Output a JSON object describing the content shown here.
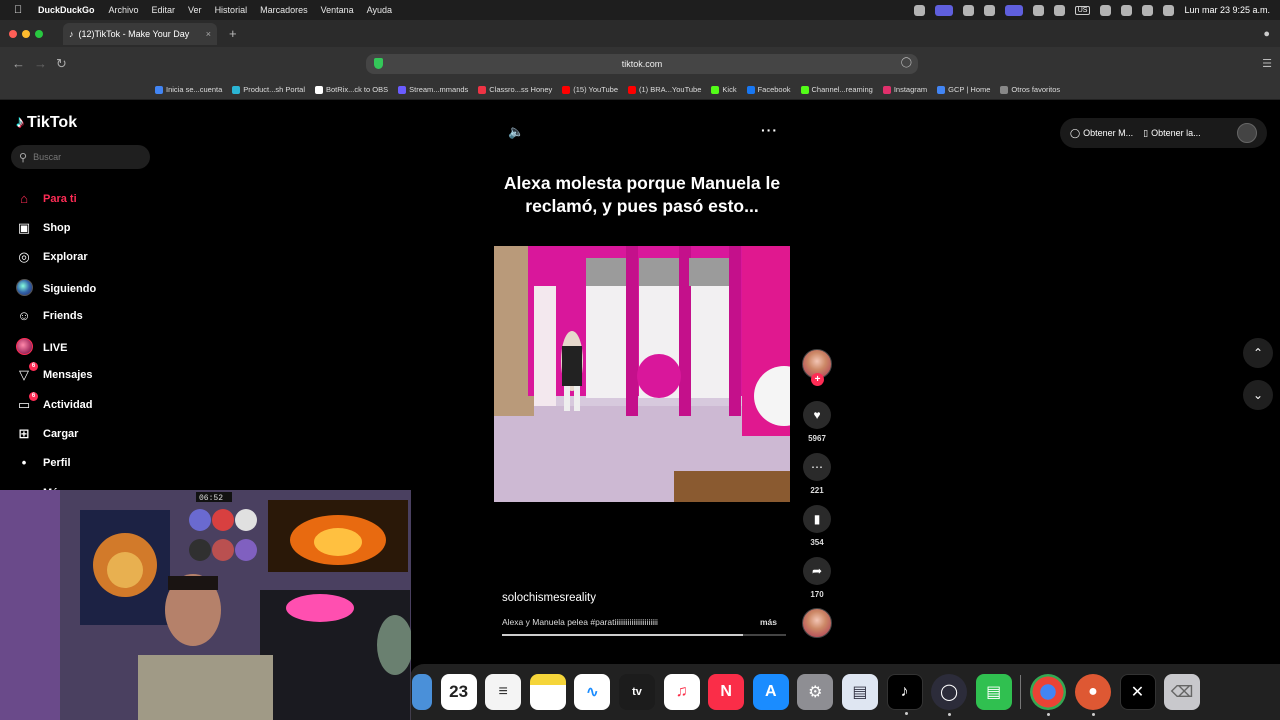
{
  "menubar": {
    "app_name": "DuckDuckGo",
    "items": [
      "Archivo",
      "Editar",
      "Ver",
      "Historial",
      "Marcadores",
      "Ventana",
      "Ayuda"
    ],
    "keyboard_layout": "US",
    "clock": "Lun mar 23  9:25 a.m."
  },
  "browser": {
    "tab_title": "(12)TikTok - Make Your Day",
    "tab_close": "×",
    "new_tab": "+",
    "url": "tiktok.com",
    "bookmarks": [
      {
        "label": "Inicia se...cuenta",
        "color": "#4285f4"
      },
      {
        "label": "Product...sh Portal",
        "color": "#2bb5d4"
      },
      {
        "label": "BotRix...ck to OBS",
        "color": "#ffffff"
      },
      {
        "label": "Stream...mmands",
        "color": "#6a5cff"
      },
      {
        "label": "Classro...ss Honey",
        "color": "#e34"
      },
      {
        "label": "(15) YouTube",
        "color": "#ff0000"
      },
      {
        "label": "(1) BRA...YouTube",
        "color": "#ff0000"
      },
      {
        "label": "Kick",
        "color": "#53fc18"
      },
      {
        "label": "Facebook",
        "color": "#1877f2"
      },
      {
        "label": "Channel...reaming",
        "color": "#53fc18"
      },
      {
        "label": "Instagram",
        "color": "#e1306c"
      },
      {
        "label": "GCP | Home",
        "color": "#4285f4"
      },
      {
        "label": "Otros favoritos",
        "color": "#888888"
      }
    ]
  },
  "tiktok": {
    "logo": "TikTok",
    "search_placeholder": "Buscar",
    "nav": [
      {
        "label": "Para ti",
        "icon": "home-icon",
        "active": true
      },
      {
        "label": "Shop",
        "icon": "shop-bag-icon"
      },
      {
        "label": "Explorar",
        "icon": "compass-icon"
      },
      {
        "label": "Siguiendo",
        "icon": "following-avatar"
      },
      {
        "label": "Friends",
        "icon": "friends-icon"
      },
      {
        "label": "LIVE",
        "icon": "live-avatar"
      },
      {
        "label": "Mensajes",
        "icon": "paper-plane-icon",
        "badge": "6"
      },
      {
        "label": "Actividad",
        "icon": "message-icon",
        "badge": "6"
      },
      {
        "label": "Cargar",
        "icon": "upload-plus-icon"
      },
      {
        "label": "Perfil",
        "icon": "profile-icon"
      },
      {
        "label": "Más",
        "icon": "more-dots-icon"
      }
    ],
    "top_buttons": [
      {
        "label": "Obtener M...",
        "icon": "coin-icon"
      },
      {
        "label": "Obtener la...",
        "icon": "phone-icon"
      }
    ],
    "video": {
      "caption": "Alexa molesta porque Manuela le reclamó, y pues pasó esto...",
      "username": "solochismesreality",
      "description": "Alexa y Manuela pelea #paratiiiiiiiiiiiiiiiiiiiiiii",
      "more": "más",
      "progress": 0.85,
      "likes": "5967",
      "comments": "221",
      "saves": "354",
      "shares": "170"
    }
  },
  "webcam": {
    "clock_display": "06:52"
  },
  "dock": {
    "calendar_day": "23",
    "apps": [
      "finder",
      "calendar",
      "reminders",
      "notes",
      "freeform",
      "apple-tv",
      "music",
      "news",
      "app-store",
      "system-settings",
      "preview",
      "tiktok",
      "obs",
      "numbers",
      "chrome",
      "duckduckgo",
      "capcut",
      "trash"
    ]
  }
}
